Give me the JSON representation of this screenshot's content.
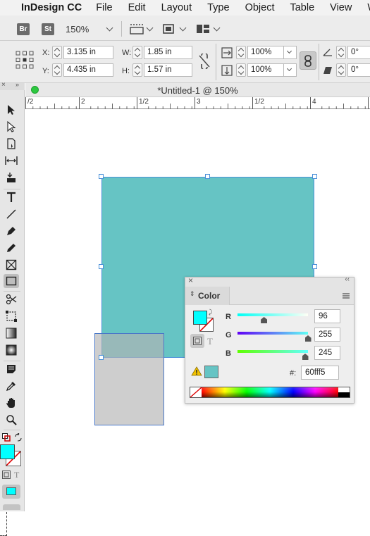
{
  "menubar": {
    "app_name": "InDesign CC",
    "items": [
      "File",
      "Edit",
      "Layout",
      "Type",
      "Object",
      "Table",
      "View",
      "W"
    ]
  },
  "appbar": {
    "bridge_label": "Br",
    "stock_label": "St",
    "zoom": "150%"
  },
  "control": {
    "x_label": "X:",
    "x_value": "3.135 in",
    "y_label": "Y:",
    "y_value": "4.435 in",
    "w_label": "W:",
    "w_value": "1.85 in",
    "h_label": "H:",
    "h_value": "1.57 in",
    "scale_x": "100%",
    "scale_y": "100%",
    "rotate": "0°",
    "shear": "0°"
  },
  "document": {
    "title": "*Untitled-1 @ 150%",
    "ruler_labels": [
      "/2",
      "2",
      "1/2",
      "3",
      "1/2",
      "4"
    ],
    "teal_color": "#66c4c4",
    "gray_color": "#cbcbcb"
  },
  "color_panel": {
    "tab_label": "Color",
    "r_label": "R",
    "r_value": "96",
    "g_label": "G",
    "g_value": "255",
    "b_label": "B",
    "b_value": "245",
    "hex_label": "#:",
    "hex_value": "60fff5",
    "fill_color": "#00ffff",
    "swatch_color": "#66c4c4",
    "r_fraction": 0.376,
    "g_fraction": 1.0,
    "b_fraction": 0.96
  },
  "toolbar": {
    "fill_color": "#00ffff"
  }
}
